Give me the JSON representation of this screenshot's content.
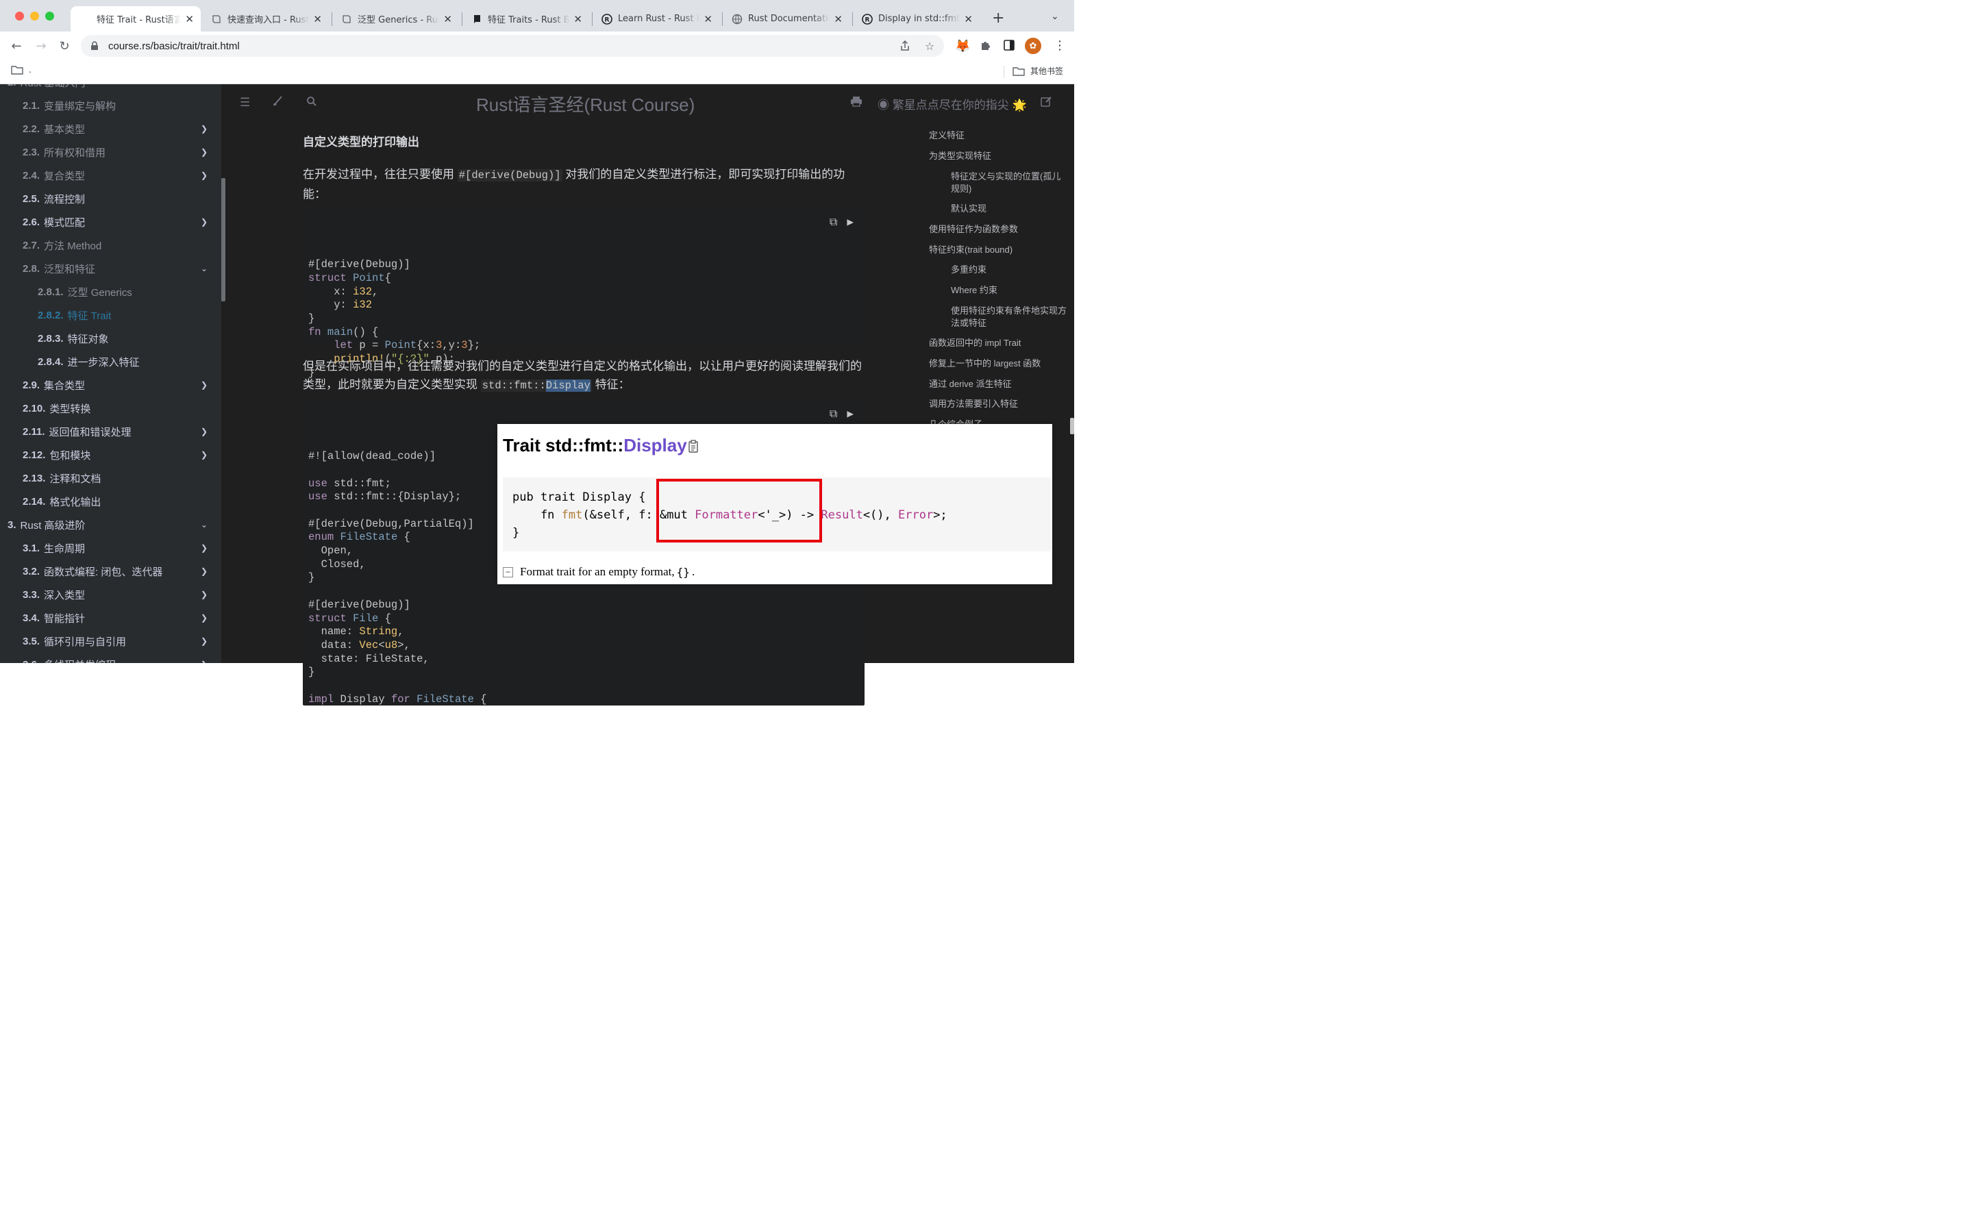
{
  "browser": {
    "tabs": [
      {
        "label": "特征 Trait - Rust语言圣经",
        "icon": "book-icon"
      },
      {
        "label": "快速查询入口 - Rust",
        "icon": "book-icon"
      },
      {
        "label": "泛型 Generics - Rust",
        "icon": "book-icon"
      },
      {
        "label": "特征 Traits - Rust By",
        "icon": "book-dark-icon"
      },
      {
        "label": "Learn Rust - Rust P",
        "icon": "rust-icon"
      },
      {
        "label": "Rust Documentation",
        "icon": "globe-icon"
      },
      {
        "label": "Display in std::fmt",
        "icon": "rust-icon"
      }
    ],
    "new_tab": "+",
    "url": "course.rs/basic/trait/trait.html",
    "bookmarks": {
      "left": ".",
      "right": "其他书签"
    }
  },
  "book": {
    "title": "Rust语言圣经(Rust Course)",
    "github_text": "繁星点点尽在你的指尖 🌟"
  },
  "sidebar": {
    "items": [
      {
        "num": "2. ",
        "label": "Rust 基础入门",
        "level": 0,
        "state": "dim",
        "chevron": ""
      },
      {
        "num": "2.1.",
        "label": "变量绑定与解构",
        "level": 1,
        "state": "dim",
        "chevron": ""
      },
      {
        "num": "2.2.",
        "label": "基本类型",
        "level": 1,
        "state": "dim",
        "chevron": "❯"
      },
      {
        "num": "2.3.",
        "label": "所有权和借用",
        "level": 1,
        "state": "dim",
        "chevron": "❯"
      },
      {
        "num": "2.4.",
        "label": "复合类型",
        "level": 1,
        "state": "dim",
        "chevron": "❯"
      },
      {
        "num": "2.5.",
        "label": "流程控制",
        "level": 1,
        "state": "normal",
        "chevron": ""
      },
      {
        "num": "2.6.",
        "label": "模式匹配",
        "level": 1,
        "state": "normal",
        "chevron": "❯"
      },
      {
        "num": "2.7.",
        "label": "方法 Method",
        "level": 1,
        "state": "dim",
        "chevron": ""
      },
      {
        "num": "2.8.",
        "label": "泛型和特征",
        "level": 1,
        "state": "dim",
        "chevron": "⌄"
      },
      {
        "num": "2.8.1.",
        "label": "泛型 Generics",
        "level": 2,
        "state": "dim",
        "chevron": ""
      },
      {
        "num": "2.8.2.",
        "label": "特征 Trait",
        "level": 2,
        "state": "active",
        "chevron": ""
      },
      {
        "num": "2.8.3.",
        "label": "特征对象",
        "level": 2,
        "state": "normal",
        "chevron": ""
      },
      {
        "num": "2.8.4.",
        "label": "进一步深入特征",
        "level": 2,
        "state": "normal",
        "chevron": ""
      },
      {
        "num": "2.9.",
        "label": "集合类型",
        "level": 1,
        "state": "normal",
        "chevron": "❯"
      },
      {
        "num": "2.10.",
        "label": "类型转换",
        "level": 1,
        "state": "normal",
        "chevron": ""
      },
      {
        "num": "2.11.",
        "label": "返回值和错误处理",
        "level": 1,
        "state": "normal",
        "chevron": "❯"
      },
      {
        "num": "2.12.",
        "label": "包和模块",
        "level": 1,
        "state": "normal",
        "chevron": "❯"
      },
      {
        "num": "2.13.",
        "label": "注释和文档",
        "level": 1,
        "state": "normal",
        "chevron": ""
      },
      {
        "num": "2.14.",
        "label": "格式化输出",
        "level": 1,
        "state": "normal",
        "chevron": ""
      },
      {
        "num": "3.",
        "label": "Rust 高级进阶",
        "level": 0,
        "state": "normal",
        "chevron": "⌄"
      },
      {
        "num": "3.1.",
        "label": "生命周期",
        "level": 1,
        "state": "normal",
        "chevron": "❯"
      },
      {
        "num": "3.2.",
        "label": "函数式编程: 闭包、迭代器",
        "level": 1,
        "state": "normal",
        "chevron": "❯"
      },
      {
        "num": "3.3.",
        "label": "深入类型",
        "level": 1,
        "state": "normal",
        "chevron": "❯"
      },
      {
        "num": "3.4.",
        "label": "智能指针",
        "level": 1,
        "state": "normal",
        "chevron": "❯"
      },
      {
        "num": "3.5.",
        "label": "循环引用与自引用",
        "level": 1,
        "state": "normal",
        "chevron": "❯"
      },
      {
        "num": "3.6.",
        "label": "多线程并发编程",
        "level": 1,
        "state": "normal",
        "chevron": "❯"
      }
    ]
  },
  "content": {
    "heading": "自定义类型的打印输出",
    "para1_a": "在开发过程中，往往只要使用 ",
    "para1_code": "#[derive(Debug)]",
    "para1_b": " 对我们的自定义类型进行标注，即可实现打印输出的功能：",
    "para2_a": "但是在实际项目中，往往需要对我们的自定义类型进行自定义的格式化输出，以让用户更好的阅读理解我们的类型，此时就要为自定义类型实现 ",
    "para2_code_a": "std::fmt::",
    "para2_code_b": "Display",
    "para2_b": " 特征：",
    "code1": [
      "#[derive(Debug)]",
      "struct Point{",
      "    x: i32,",
      "    y: i32",
      "}",
      "fn main() {",
      "    let p = Point{x:3,y:3};",
      "    println!(\"{:?}\",p);",
      "}"
    ],
    "code2": [
      "#![allow(dead_code)]",
      "",
      "use std::fmt;",
      "use std::fmt::{Display};",
      "",
      "#[derive(Debug,PartialEq)]",
      "enum FileState {",
      "  Open,",
      "  Closed,",
      "}",
      "",
      "#[derive(Debug)]",
      "struct File {",
      "  name: String,",
      "  data: Vec<u8>,",
      "  state: FileState,",
      "}",
      "",
      "impl Display for FileState {"
    ]
  },
  "toc": {
    "items": [
      {
        "label": "定义特征",
        "indent": false
      },
      {
        "label": "为类型实现特征",
        "indent": false
      },
      {
        "label": "特征定义与实现的位置(孤儿规则)",
        "indent": true
      },
      {
        "label": "默认实现",
        "indent": true
      },
      {
        "label": "使用特征作为函数参数",
        "indent": false
      },
      {
        "label": "特征约束(trait bound)",
        "indent": false
      },
      {
        "label": "多重约束",
        "indent": true
      },
      {
        "label": "Where 约束",
        "indent": true
      },
      {
        "label": "使用特征约束有条件地实现方法或特征",
        "indent": true
      },
      {
        "label": "函数返回中的 impl Trait",
        "indent": false
      },
      {
        "label": "修复上一节中的 largest 函数",
        "indent": false
      },
      {
        "label": "通过 derive 派生特征",
        "indent": false
      },
      {
        "label": "调用方法需要引入特征",
        "indent": false
      },
      {
        "label": "几个综合例子",
        "indent": false
      }
    ]
  },
  "popup": {
    "title_prefix": "Trait std::fmt::",
    "title_trait": "Display",
    "code_line1": "pub trait Display {",
    "code_line2_a": "    fn ",
    "code_line2_fn": "fmt",
    "code_line2_b": "(&self, f: &mut ",
    "code_line2_type1": "Formatter",
    "code_line2_c": "<'_>) -> ",
    "code_line2_type2": "Result",
    "code_line2_d": "<(), ",
    "code_line2_type3": "Error",
    "code_line2_e": ">;",
    "code_line3": "}",
    "collapse": "−",
    "desc_a": "Format trait for an empty format, ",
    "desc_code": "{}",
    "desc_b": "."
  },
  "colors": {
    "active_link": "#2b79a2",
    "highlight_box": "#e8000b",
    "trait_name": "#6e4fc9"
  }
}
